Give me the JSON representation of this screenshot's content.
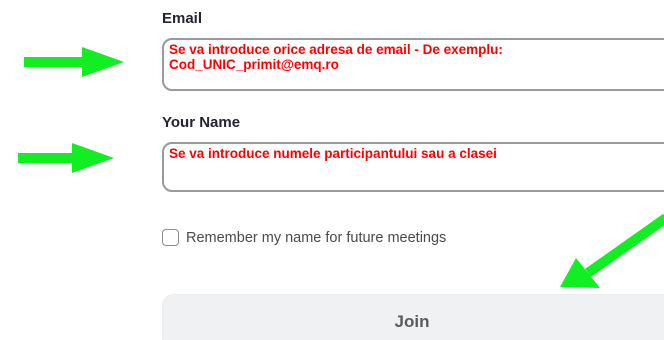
{
  "email": {
    "label": "Email",
    "value": "Se va introduce orice adresa de email - De exemplu:\nCod_UNIC_primit@emq.ro"
  },
  "name": {
    "label": "Your Name",
    "value": "Se va introduce numele participantului sau a clasei"
  },
  "remember": {
    "label": "Remember my name for future meetings",
    "checked": false
  },
  "join": {
    "label": "Join"
  },
  "colors": {
    "annotation_arrow": "#11ee22",
    "annotation_text": "#ff0000",
    "field_border": "#9a9a9a",
    "button_background": "#f0f1f3"
  }
}
